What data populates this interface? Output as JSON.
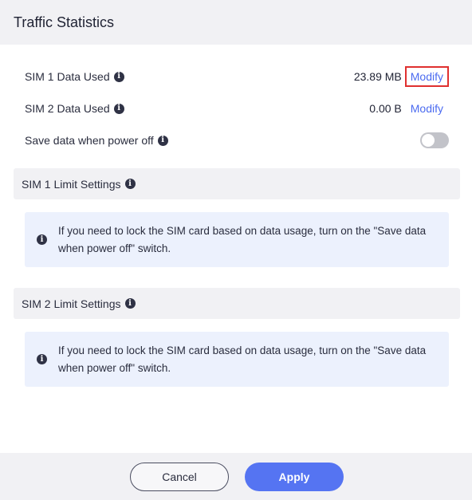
{
  "header": {
    "title": "Traffic Statistics"
  },
  "rows": {
    "sim1": {
      "label": "SIM 1 Data Used",
      "value": "23.89 MB",
      "action": "Modify"
    },
    "sim2": {
      "label": "SIM 2 Data Used",
      "value": "0.00 B",
      "action": "Modify"
    },
    "save_data": {
      "label": "Save data when power off",
      "enabled": false
    }
  },
  "sections": {
    "sim1_limit": {
      "title": "SIM 1 Limit Settings",
      "notice": "If you need to lock the SIM card based on data usage, turn on the \"Save data when power off\" switch."
    },
    "sim2_limit": {
      "title": "SIM 2 Limit Settings",
      "notice": "If you need to lock the SIM card based on data usage, turn on the \"Save data when power off\" switch."
    }
  },
  "footer": {
    "cancel_label": "Cancel",
    "apply_label": "Apply"
  },
  "icons": {
    "info": "info-icon",
    "toggle": "toggle-switch"
  },
  "colors": {
    "accent": "#5574f2",
    "link": "#4b6bf0",
    "highlight_border": "#e0302f",
    "toggle_off": "#c2c3c9",
    "notice_bg": "#ecf1fd",
    "panel_bg": "#f1f1f4"
  }
}
